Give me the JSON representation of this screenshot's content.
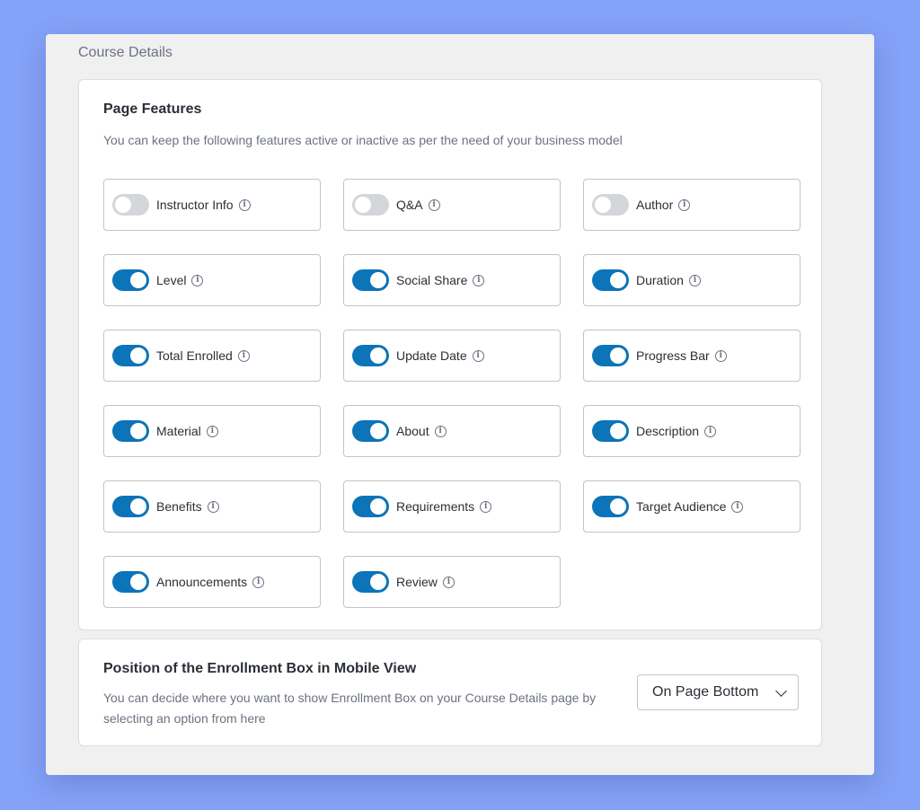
{
  "section_title": "Course Details",
  "page_features": {
    "title": "Page Features",
    "description": "You can keep the following features active or inactive as per the need of your business model",
    "items": [
      {
        "label": "Instructor Info",
        "enabled": false
      },
      {
        "label": "Q&A",
        "enabled": false
      },
      {
        "label": "Author",
        "enabled": false
      },
      {
        "label": "Level",
        "enabled": true
      },
      {
        "label": "Social Share",
        "enabled": true
      },
      {
        "label": "Duration",
        "enabled": true
      },
      {
        "label": "Total Enrolled",
        "enabled": true
      },
      {
        "label": "Update Date",
        "enabled": true
      },
      {
        "label": "Progress Bar",
        "enabled": true
      },
      {
        "label": "Material",
        "enabled": true
      },
      {
        "label": "About",
        "enabled": true
      },
      {
        "label": "Description",
        "enabled": true
      },
      {
        "label": "Benefits",
        "enabled": true
      },
      {
        "label": "Requirements",
        "enabled": true
      },
      {
        "label": "Target Audience",
        "enabled": true
      },
      {
        "label": "Announcements",
        "enabled": true
      },
      {
        "label": "Review",
        "enabled": true
      }
    ]
  },
  "enrollment_box": {
    "title": "Position of the Enrollment Box in Mobile View",
    "description": "You can decide where you want to show Enrollment Box on your Course Details page by selecting an option from here",
    "selected": "On Page Bottom"
  },
  "icons": {
    "info": "info-icon",
    "dropdown": "chevron-down-icon"
  },
  "colors": {
    "toggle_on": "#0c74b8",
    "toggle_off": "#d4d6db",
    "background": "#84a2f7"
  }
}
